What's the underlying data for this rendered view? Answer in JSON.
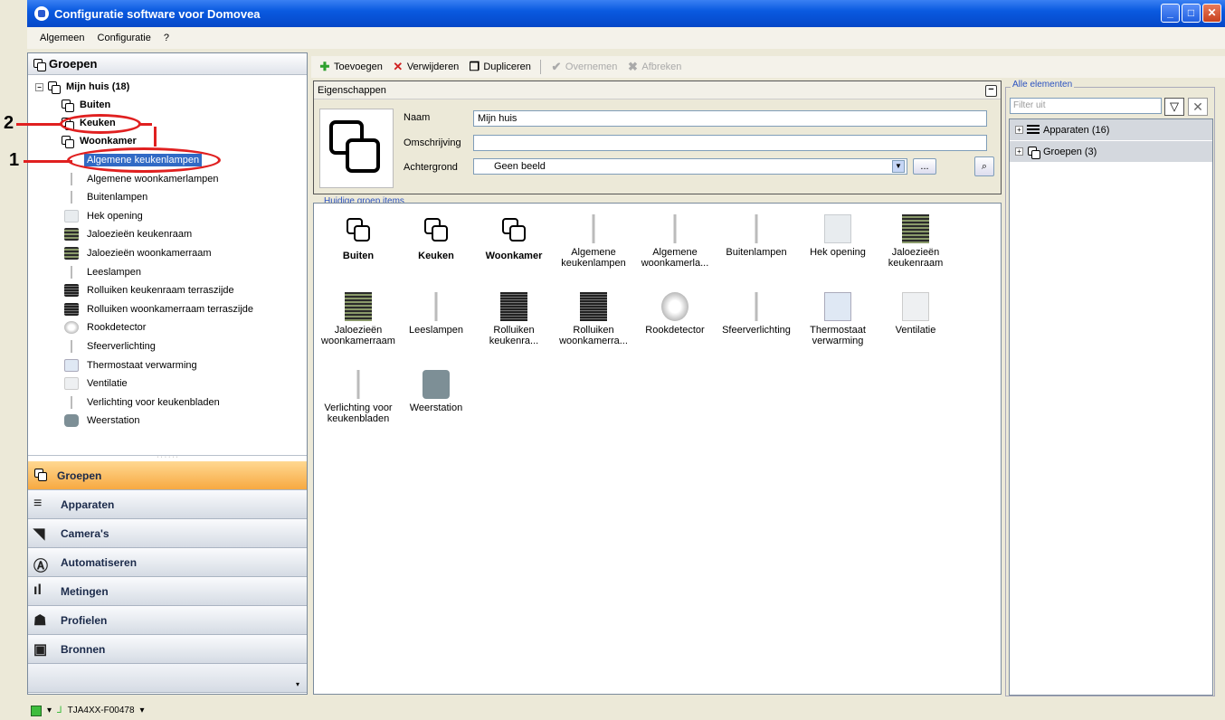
{
  "window": {
    "title": "Configuratie software voor Domovea",
    "btn_min": "_",
    "btn_max": "□",
    "btn_close": "✕"
  },
  "menu": [
    "Algemeen",
    "Configuratie",
    "?"
  ],
  "left": {
    "header": "Groepen",
    "tree": {
      "root": "Mijn huis (18)",
      "groups": [
        "Buiten",
        "Keuken",
        "Woonkamer"
      ],
      "items": [
        "Algemene keukenlampen",
        "Algemene woonkamerlampen",
        "Buitenlampen",
        "Hek opening",
        "Jaloezieën keukenraam",
        "Jaloezieën woonkamerraam",
        "Leeslampen",
        "Rolluiken keukenraam terraszijde",
        "Rolluiken woonkamerraam terraszijde",
        "Rookdetector",
        "Sfeerverlichting",
        "Thermostaat verwarming",
        "Ventilatie",
        "Verlichting voor keukenbladen",
        "Weerstation"
      ],
      "selected": "Algemene keukenlampen"
    },
    "nav": [
      "Groepen",
      "Apparaten",
      "Camera's",
      "Automatiseren",
      "Metingen",
      "Profielen",
      "Bronnen"
    ]
  },
  "toolbar": {
    "add": "Toevoegen",
    "delete": "Verwijderen",
    "duplicate": "Dupliceren",
    "apply": "Overnemen",
    "cancel": "Afbreken"
  },
  "props": {
    "title": "Eigenschappen",
    "naam_label": "Naam",
    "naam_value": "Mijn huis",
    "omschrijving_label": "Omschrijving",
    "omschrijving_value": "",
    "achtergrond_label": "Achtergrond",
    "achtergrond_value": "Geen beeld",
    "browse": "..."
  },
  "items": {
    "legend": "Huidige groep items",
    "list": [
      {
        "label": "Buiten",
        "kind": "group"
      },
      {
        "label": "Keuken",
        "kind": "group"
      },
      {
        "label": "Woonkamer",
        "kind": "group"
      },
      {
        "label": "Algemene keukenlampen",
        "kind": "lamp"
      },
      {
        "label": "Algemene woonkamerla...",
        "kind": "lamp"
      },
      {
        "label": "Buitenlampen",
        "kind": "lamp2"
      },
      {
        "label": "Hek opening",
        "kind": "door"
      },
      {
        "label": "Jaloezieën keukenraam",
        "kind": "blind"
      },
      {
        "label": "Jaloezieën woonkamerraam",
        "kind": "blind"
      },
      {
        "label": "Leeslampen",
        "kind": "lamp2"
      },
      {
        "label": "Rolluiken keukenra...",
        "kind": "shutter"
      },
      {
        "label": "Rolluiken woonkamerra...",
        "kind": "shutter"
      },
      {
        "label": "Rookdetector",
        "kind": "smoke"
      },
      {
        "label": "Sfeerverlichting",
        "kind": "lamp"
      },
      {
        "label": "Thermostaat verwarming",
        "kind": "thermo"
      },
      {
        "label": "Ventilatie",
        "kind": "vent"
      },
      {
        "label": "Verlichting voor keukenbladen",
        "kind": "lamp2"
      },
      {
        "label": "Weerstation",
        "kind": "weather"
      }
    ]
  },
  "right": {
    "legend": "Alle elementen",
    "filter_placeholder": "Filter uit",
    "rows": [
      "Apparaten (16)",
      "Groepen (3)"
    ]
  },
  "status": {
    "device": "TJA4XX-F00478"
  },
  "annotations": [
    "1",
    "2"
  ]
}
